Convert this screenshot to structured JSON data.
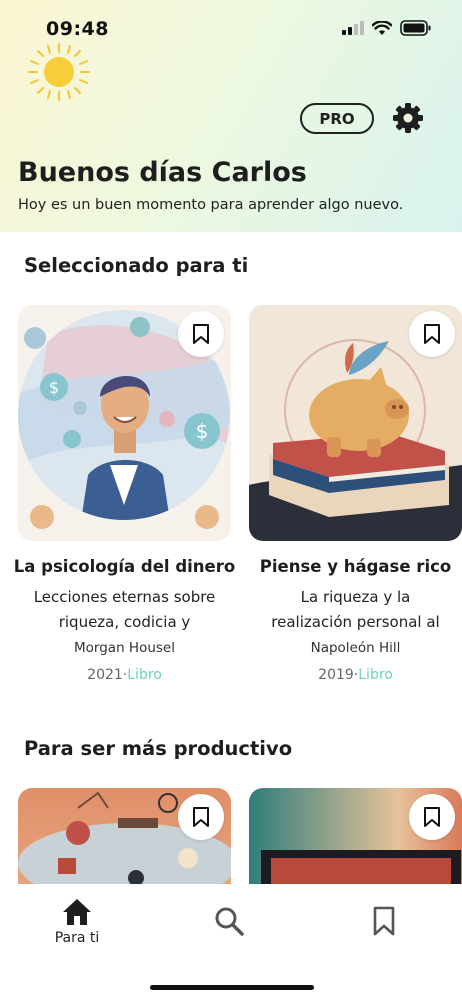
{
  "status_bar": {
    "time": "09:48"
  },
  "header": {
    "pro_label": "PRO",
    "greeting": "Buenos días Carlos",
    "subtitle": "Hoy es un buen momento para aprender algo nuevo."
  },
  "sections": [
    {
      "title": "Seleccionado para ti",
      "cards": [
        {
          "title": "La psicología del dinero",
          "description_lines": [
            "Lecciones eternas sobre",
            "riqueza, codicia y"
          ],
          "author": "Morgan Housel",
          "year": "2021",
          "separator": "·",
          "type": "Libro"
        },
        {
          "title": "Piense y hágase rico",
          "description_lines": [
            "La riqueza y la",
            "realización personal al"
          ],
          "author": "Napoleón Hill",
          "year": "2019",
          "separator": "·",
          "type": "Libro"
        }
      ]
    },
    {
      "title": "Para ser más productivo"
    }
  ],
  "tabbar": {
    "tabs": [
      {
        "label": "Para ti",
        "icon": "home-icon",
        "active": true
      },
      {
        "label": "",
        "icon": "search-icon",
        "active": false
      },
      {
        "label": "",
        "icon": "bookmark-icon",
        "active": false
      }
    ]
  },
  "colors": {
    "accent": "#6fd3b6",
    "text": "#1e1e1e",
    "meta": "#666666"
  }
}
